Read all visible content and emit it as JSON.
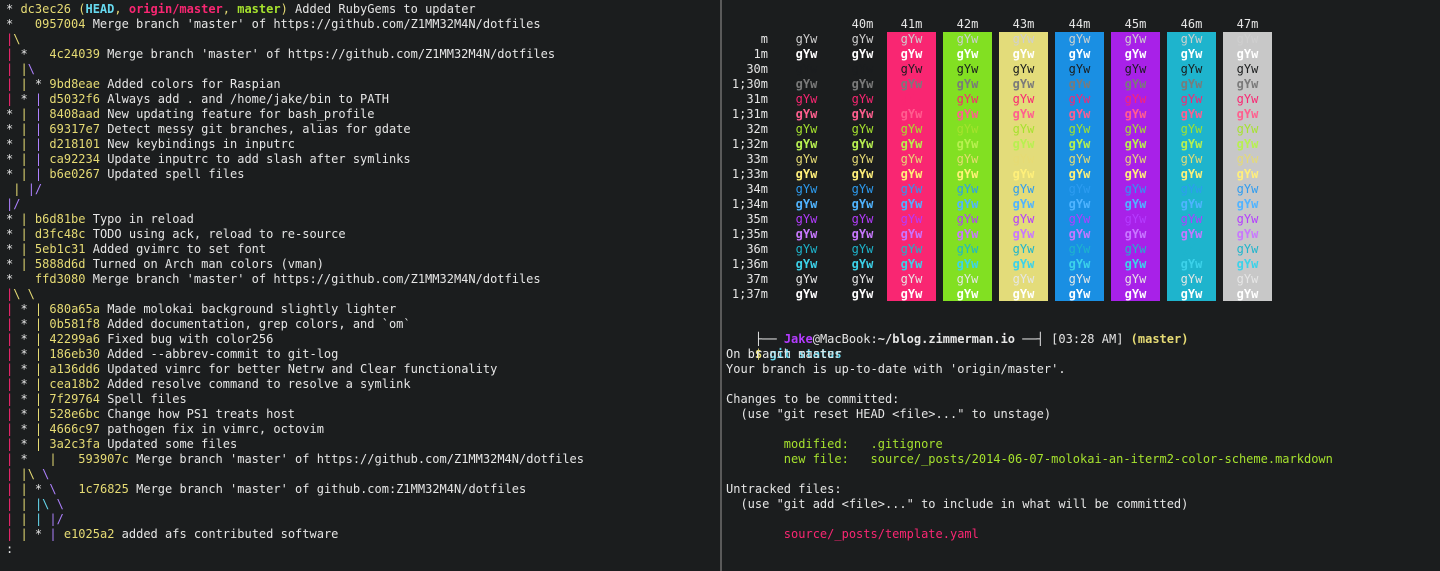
{
  "colors": {
    "default": "#e6e6e6",
    "yellow": "#e6db74",
    "magenta": "#f92672",
    "green": "#a6e22e",
    "purple": "#ae81ff",
    "cyan": "#66d9ef",
    "blue": "#2d9cf0",
    "violet": "#b43cff",
    "white": "#f8f8f2",
    "grey": "#7a7a7a"
  },
  "git_log": [
    [
      {
        "t": "* ",
        "c": "default"
      },
      {
        "t": "dc3ec26",
        "c": "yellow"
      },
      {
        "t": " (",
        "c": "yellow"
      },
      {
        "t": "HEAD",
        "c": "cyan",
        "b": true
      },
      {
        "t": ", ",
        "c": "yellow"
      },
      {
        "t": "origin/master",
        "c": "magenta",
        "b": true
      },
      {
        "t": ", ",
        "c": "yellow"
      },
      {
        "t": "master",
        "c": "green",
        "b": true
      },
      {
        "t": ")",
        "c": "yellow"
      },
      {
        "t": " Added RubyGems to updater",
        "c": "default"
      }
    ],
    [
      {
        "t": "*   ",
        "c": "default"
      },
      {
        "t": "0957004",
        "c": "yellow"
      },
      {
        "t": " Merge branch 'master' of https://github.com/Z1MM32M4N/dotfiles",
        "c": "default"
      }
    ],
    [
      {
        "t": "|",
        "c": "magenta"
      },
      {
        "t": "\\",
        "c": "yellow"
      }
    ],
    [
      {
        "t": "|",
        "c": "magenta"
      },
      {
        "t": " *   ",
        "c": "default"
      },
      {
        "t": "4c24039",
        "c": "yellow"
      },
      {
        "t": " Merge branch 'master' of https://github.com/Z1MM32M4N/dotfiles",
        "c": "default"
      }
    ],
    [
      {
        "t": "|",
        "c": "magenta"
      },
      {
        "t": " ",
        "c": "default"
      },
      {
        "t": "|",
        "c": "yellow"
      },
      {
        "t": "\\",
        "c": "purple"
      }
    ],
    [
      {
        "t": "|",
        "c": "magenta"
      },
      {
        "t": " ",
        "c": "default"
      },
      {
        "t": "|",
        "c": "yellow"
      },
      {
        "t": " * ",
        "c": "default"
      },
      {
        "t": "9bd8eae",
        "c": "yellow"
      },
      {
        "t": " Added colors for Raspian",
        "c": "default"
      }
    ],
    [
      {
        "t": "|",
        "c": "magenta"
      },
      {
        "t": " * ",
        "c": "default"
      },
      {
        "t": "|",
        "c": "purple"
      },
      {
        "t": " ",
        "c": "default"
      },
      {
        "t": "d5032f6",
        "c": "yellow"
      },
      {
        "t": " Always add . and /home/jake/bin to PATH",
        "c": "default"
      }
    ],
    [
      {
        "t": "* ",
        "c": "default"
      },
      {
        "t": "|",
        "c": "yellow"
      },
      {
        "t": " ",
        "c": "default"
      },
      {
        "t": "|",
        "c": "purple"
      },
      {
        "t": " ",
        "c": "default"
      },
      {
        "t": "8408aad",
        "c": "yellow"
      },
      {
        "t": " New updating feature for bash_profile",
        "c": "default"
      }
    ],
    [
      {
        "t": "* ",
        "c": "default"
      },
      {
        "t": "|",
        "c": "yellow"
      },
      {
        "t": " ",
        "c": "default"
      },
      {
        "t": "|",
        "c": "purple"
      },
      {
        "t": " ",
        "c": "default"
      },
      {
        "t": "69317e7",
        "c": "yellow"
      },
      {
        "t": " Detect messy git branches, alias for gdate",
        "c": "default"
      }
    ],
    [
      {
        "t": "* ",
        "c": "default"
      },
      {
        "t": "|",
        "c": "yellow"
      },
      {
        "t": " ",
        "c": "default"
      },
      {
        "t": "|",
        "c": "purple"
      },
      {
        "t": " ",
        "c": "default"
      },
      {
        "t": "d218101",
        "c": "yellow"
      },
      {
        "t": " New keybindings in inputrc",
        "c": "default"
      }
    ],
    [
      {
        "t": "* ",
        "c": "default"
      },
      {
        "t": "|",
        "c": "yellow"
      },
      {
        "t": " ",
        "c": "default"
      },
      {
        "t": "|",
        "c": "purple"
      },
      {
        "t": " ",
        "c": "default"
      },
      {
        "t": "ca92234",
        "c": "yellow"
      },
      {
        "t": " Update inputrc to add slash after symlinks",
        "c": "default"
      }
    ],
    [
      {
        "t": "* ",
        "c": "default"
      },
      {
        "t": "|",
        "c": "yellow"
      },
      {
        "t": " ",
        "c": "default"
      },
      {
        "t": "|",
        "c": "purple"
      },
      {
        "t": " ",
        "c": "default"
      },
      {
        "t": "b6e0267",
        "c": "yellow"
      },
      {
        "t": " Updated spell files",
        "c": "default"
      }
    ],
    [
      {
        "t": " ",
        "c": "default"
      },
      {
        "t": "|",
        "c": "yellow"
      },
      {
        "t": " ",
        "c": "default"
      },
      {
        "t": "|/",
        "c": "purple"
      }
    ],
    [
      {
        "t": "|/",
        "c": "purple"
      }
    ],
    [
      {
        "t": "* ",
        "c": "default"
      },
      {
        "t": "|",
        "c": "yellow"
      },
      {
        "t": " ",
        "c": "default"
      },
      {
        "t": "b6d81be",
        "c": "yellow"
      },
      {
        "t": " Typo in reload",
        "c": "default"
      }
    ],
    [
      {
        "t": "* ",
        "c": "default"
      },
      {
        "t": "|",
        "c": "yellow"
      },
      {
        "t": " ",
        "c": "default"
      },
      {
        "t": "d3fc48c",
        "c": "yellow"
      },
      {
        "t": " TODO using ack, reload to re-source",
        "c": "default"
      }
    ],
    [
      {
        "t": "* ",
        "c": "default"
      },
      {
        "t": "|",
        "c": "yellow"
      },
      {
        "t": " ",
        "c": "default"
      },
      {
        "t": "5eb1c31",
        "c": "yellow"
      },
      {
        "t": " Added gvimrc to set font",
        "c": "default"
      }
    ],
    [
      {
        "t": "* ",
        "c": "default"
      },
      {
        "t": "|",
        "c": "yellow"
      },
      {
        "t": " ",
        "c": "default"
      },
      {
        "t": "5888d6d",
        "c": "yellow"
      },
      {
        "t": " Turned on Arch man colors (vman)",
        "c": "default"
      }
    ],
    [
      {
        "t": "*   ",
        "c": "default"
      },
      {
        "t": "ffd3080",
        "c": "yellow"
      },
      {
        "t": " Merge branch 'master' of https://github.com/Z1MM32M4N/dotfiles",
        "c": "default"
      }
    ],
    [
      {
        "t": "|",
        "c": "magenta"
      },
      {
        "t": "\\ \\",
        "c": "yellow"
      }
    ],
    [
      {
        "t": "|",
        "c": "magenta"
      },
      {
        "t": " * ",
        "c": "default"
      },
      {
        "t": "|",
        "c": "yellow"
      },
      {
        "t": " ",
        "c": "default"
      },
      {
        "t": "680a65a",
        "c": "yellow"
      },
      {
        "t": " Made molokai background slightly lighter",
        "c": "default"
      }
    ],
    [
      {
        "t": "|",
        "c": "magenta"
      },
      {
        "t": " * ",
        "c": "default"
      },
      {
        "t": "|",
        "c": "yellow"
      },
      {
        "t": " ",
        "c": "default"
      },
      {
        "t": "0b581f8",
        "c": "yellow"
      },
      {
        "t": " Added documentation, grep colors, and `om`",
        "c": "default"
      }
    ],
    [
      {
        "t": "|",
        "c": "magenta"
      },
      {
        "t": " * ",
        "c": "default"
      },
      {
        "t": "|",
        "c": "yellow"
      },
      {
        "t": " ",
        "c": "default"
      },
      {
        "t": "42299a6",
        "c": "yellow"
      },
      {
        "t": " Fixed bug with color256",
        "c": "default"
      }
    ],
    [
      {
        "t": "|",
        "c": "magenta"
      },
      {
        "t": " * ",
        "c": "default"
      },
      {
        "t": "|",
        "c": "yellow"
      },
      {
        "t": " ",
        "c": "default"
      },
      {
        "t": "186eb30",
        "c": "yellow"
      },
      {
        "t": " Added --abbrev-commit to git-log",
        "c": "default"
      }
    ],
    [
      {
        "t": "|",
        "c": "magenta"
      },
      {
        "t": " * ",
        "c": "default"
      },
      {
        "t": "|",
        "c": "yellow"
      },
      {
        "t": " ",
        "c": "default"
      },
      {
        "t": "a136dd6",
        "c": "yellow"
      },
      {
        "t": " Updated vimrc for better Netrw and Clear functionality",
        "c": "default"
      }
    ],
    [
      {
        "t": "|",
        "c": "magenta"
      },
      {
        "t": " * ",
        "c": "default"
      },
      {
        "t": "|",
        "c": "yellow"
      },
      {
        "t": " ",
        "c": "default"
      },
      {
        "t": "cea18b2",
        "c": "yellow"
      },
      {
        "t": " Added resolve command to resolve a symlink",
        "c": "default"
      }
    ],
    [
      {
        "t": "|",
        "c": "magenta"
      },
      {
        "t": " * ",
        "c": "default"
      },
      {
        "t": "|",
        "c": "yellow"
      },
      {
        "t": " ",
        "c": "default"
      },
      {
        "t": "7f29764",
        "c": "yellow"
      },
      {
        "t": " Spell files",
        "c": "default"
      }
    ],
    [
      {
        "t": "|",
        "c": "magenta"
      },
      {
        "t": " * ",
        "c": "default"
      },
      {
        "t": "|",
        "c": "yellow"
      },
      {
        "t": " ",
        "c": "default"
      },
      {
        "t": "528e6bc",
        "c": "yellow"
      },
      {
        "t": " Change how PS1 treats host",
        "c": "default"
      }
    ],
    [
      {
        "t": "|",
        "c": "magenta"
      },
      {
        "t": " * ",
        "c": "default"
      },
      {
        "t": "|",
        "c": "yellow"
      },
      {
        "t": " ",
        "c": "default"
      },
      {
        "t": "4666c97",
        "c": "yellow"
      },
      {
        "t": " pathogen fix in vimrc, octovim",
        "c": "default"
      }
    ],
    [
      {
        "t": "|",
        "c": "magenta"
      },
      {
        "t": " * ",
        "c": "default"
      },
      {
        "t": "|",
        "c": "yellow"
      },
      {
        "t": " ",
        "c": "default"
      },
      {
        "t": "3a2c3fa",
        "c": "yellow"
      },
      {
        "t": " Updated some files",
        "c": "default"
      }
    ],
    [
      {
        "t": "|",
        "c": "magenta"
      },
      {
        "t": " *   ",
        "c": "default"
      },
      {
        "t": "|",
        "c": "yellow"
      },
      {
        "t": "   ",
        "c": "default"
      },
      {
        "t": "593907c",
        "c": "yellow"
      },
      {
        "t": " Merge branch 'master' of https://github.com/Z1MM32M4N/dotfiles",
        "c": "default"
      }
    ],
    [
      {
        "t": "|",
        "c": "magenta"
      },
      {
        "t": " ",
        "c": "default"
      },
      {
        "t": "|\\",
        "c": "yellow"
      },
      {
        "t": " ",
        "c": "default"
      },
      {
        "t": "\\",
        "c": "purple"
      }
    ],
    [
      {
        "t": "|",
        "c": "magenta"
      },
      {
        "t": " ",
        "c": "default"
      },
      {
        "t": "|",
        "c": "yellow"
      },
      {
        "t": " * ",
        "c": "default"
      },
      {
        "t": "\\",
        "c": "purple"
      },
      {
        "t": "   ",
        "c": "default"
      },
      {
        "t": "1c76825",
        "c": "yellow"
      },
      {
        "t": " Merge branch 'master' of github.com:Z1MM32M4N/dotfiles",
        "c": "default"
      }
    ],
    [
      {
        "t": "|",
        "c": "magenta"
      },
      {
        "t": " ",
        "c": "default"
      },
      {
        "t": "|",
        "c": "yellow"
      },
      {
        "t": " ",
        "c": "default"
      },
      {
        "t": "|\\",
        "c": "cyan"
      },
      {
        "t": " ",
        "c": "default"
      },
      {
        "t": "\\",
        "c": "purple"
      }
    ],
    [
      {
        "t": "|",
        "c": "magenta"
      },
      {
        "t": " ",
        "c": "default"
      },
      {
        "t": "|",
        "c": "yellow"
      },
      {
        "t": " ",
        "c": "default"
      },
      {
        "t": "|",
        "c": "cyan"
      },
      {
        "t": " ",
        "c": "default"
      },
      {
        "t": "|/",
        "c": "purple"
      }
    ],
    [
      {
        "t": "|",
        "c": "magenta"
      },
      {
        "t": " ",
        "c": "default"
      },
      {
        "t": "|",
        "c": "yellow"
      },
      {
        "t": " * ",
        "c": "default"
      },
      {
        "t": "|",
        "c": "purple"
      },
      {
        "t": " ",
        "c": "default"
      },
      {
        "t": "e1025a2",
        "c": "yellow"
      },
      {
        "t": " added afs contributed software",
        "c": "default"
      }
    ],
    [
      {
        "t": ":",
        "c": "default"
      }
    ]
  ],
  "color_table": {
    "sample": "gYw",
    "bg_headers": [
      "40m",
      "41m",
      "42m",
      "43m",
      "44m",
      "45m",
      "46m",
      "47m"
    ],
    "bg_colors": [
      "",
      "",
      "#f92672",
      "#82e022",
      "#e3dc7a",
      "#1a8fe3",
      "#a821e8",
      "#1eb4cd",
      "#c8c8c8"
    ],
    "rows": [
      {
        "label": "m",
        "fg": "#cfcfcf",
        "bold": false
      },
      {
        "label": "1m",
        "fg": "#ffffff",
        "bold": true
      },
      {
        "label": "30m",
        "fg": "#1b1d1e",
        "bold": false
      },
      {
        "label": "1;30m",
        "fg": "#7a7a7a",
        "bold": true
      },
      {
        "label": "31m",
        "fg": "#f92672",
        "bold": false
      },
      {
        "label": "1;31m",
        "fg": "#ff5f8f",
        "bold": true
      },
      {
        "label": "32m",
        "fg": "#a6e22e",
        "bold": false
      },
      {
        "label": "1;32m",
        "fg": "#b8f050",
        "bold": true
      },
      {
        "label": "33m",
        "fg": "#e6db74",
        "bold": false
      },
      {
        "label": "1;33m",
        "fg": "#fff07a",
        "bold": true
      },
      {
        "label": "34m",
        "fg": "#2d9cf0",
        "bold": false
      },
      {
        "label": "1;34m",
        "fg": "#50b4ff",
        "bold": true
      },
      {
        "label": "35m",
        "fg": "#b43cff",
        "bold": false
      },
      {
        "label": "1;35m",
        "fg": "#c878ff",
        "bold": true
      },
      {
        "label": "36m",
        "fg": "#1eb4cd",
        "bold": false
      },
      {
        "label": "1;36m",
        "fg": "#3cd2ea",
        "bold": true
      },
      {
        "label": "37m",
        "fg": "#e6e6e6",
        "bold": false
      },
      {
        "label": "1;37m",
        "fg": "#ffffff",
        "bold": true
      }
    ]
  },
  "prompt": {
    "prefix": "├── ",
    "user": "Jake",
    "at": "@",
    "host": "MacBook",
    "colon": ":",
    "path": "~/blog.zimmerman.io",
    "sep": " ──┤ ",
    "time": "[03:28 AM]",
    "branch": " (master)",
    "dollar": "$ ",
    "command": "git status"
  },
  "git_status": [
    {
      "t": "On branch master",
      "c": "default"
    },
    {
      "t": "Your branch is up-to-date with 'origin/master'.",
      "c": "default"
    },
    {
      "t": "",
      "c": "default"
    },
    {
      "t": "Changes to be committed:",
      "c": "default"
    },
    {
      "t": "  (use \"git reset HEAD <file>...\" to unstage)",
      "c": "default"
    },
    {
      "t": "",
      "c": "default"
    },
    {
      "t": "        modified:   .gitignore",
      "c": "green"
    },
    {
      "t": "        new file:   source/_posts/2014-06-07-molokai-an-iterm2-color-scheme.markdown",
      "c": "green"
    },
    {
      "t": "",
      "c": "default"
    },
    {
      "t": "Untracked files:",
      "c": "default"
    },
    {
      "t": "  (use \"git add <file>...\" to include in what will be committed)",
      "c": "default"
    },
    {
      "t": "",
      "c": "default"
    },
    {
      "t": "        source/_posts/template.yaml",
      "c": "magenta"
    }
  ]
}
